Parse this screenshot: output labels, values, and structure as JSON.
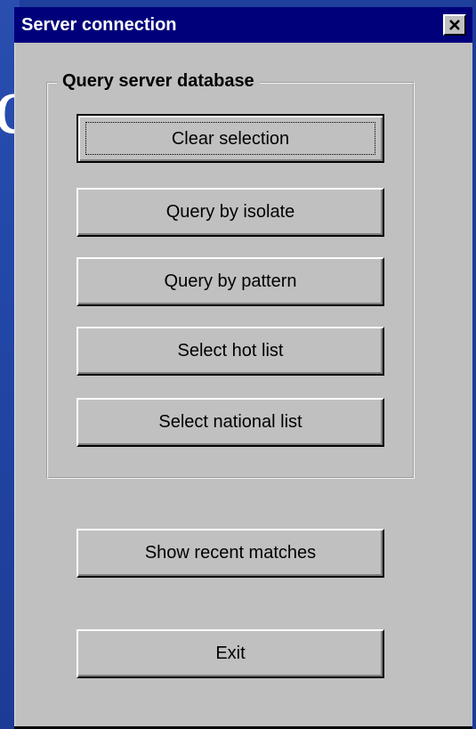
{
  "window": {
    "title": "Server connection"
  },
  "background": {
    "partial_text": "d"
  },
  "group": {
    "label": "Query server database",
    "buttons": [
      {
        "label": "Clear selection"
      },
      {
        "label": "Query by isolate"
      },
      {
        "label": "Query by pattern"
      },
      {
        "label": "Select hot list"
      },
      {
        "label": "Select national list"
      }
    ]
  },
  "actions": {
    "show_recent_label": "Show recent matches",
    "exit_label": "Exit"
  },
  "icons": {
    "close": "close-icon"
  },
  "colors": {
    "titlebar": "#00007b",
    "dialog_face": "#c0c0c0",
    "desktop": "#1f3f9c"
  }
}
